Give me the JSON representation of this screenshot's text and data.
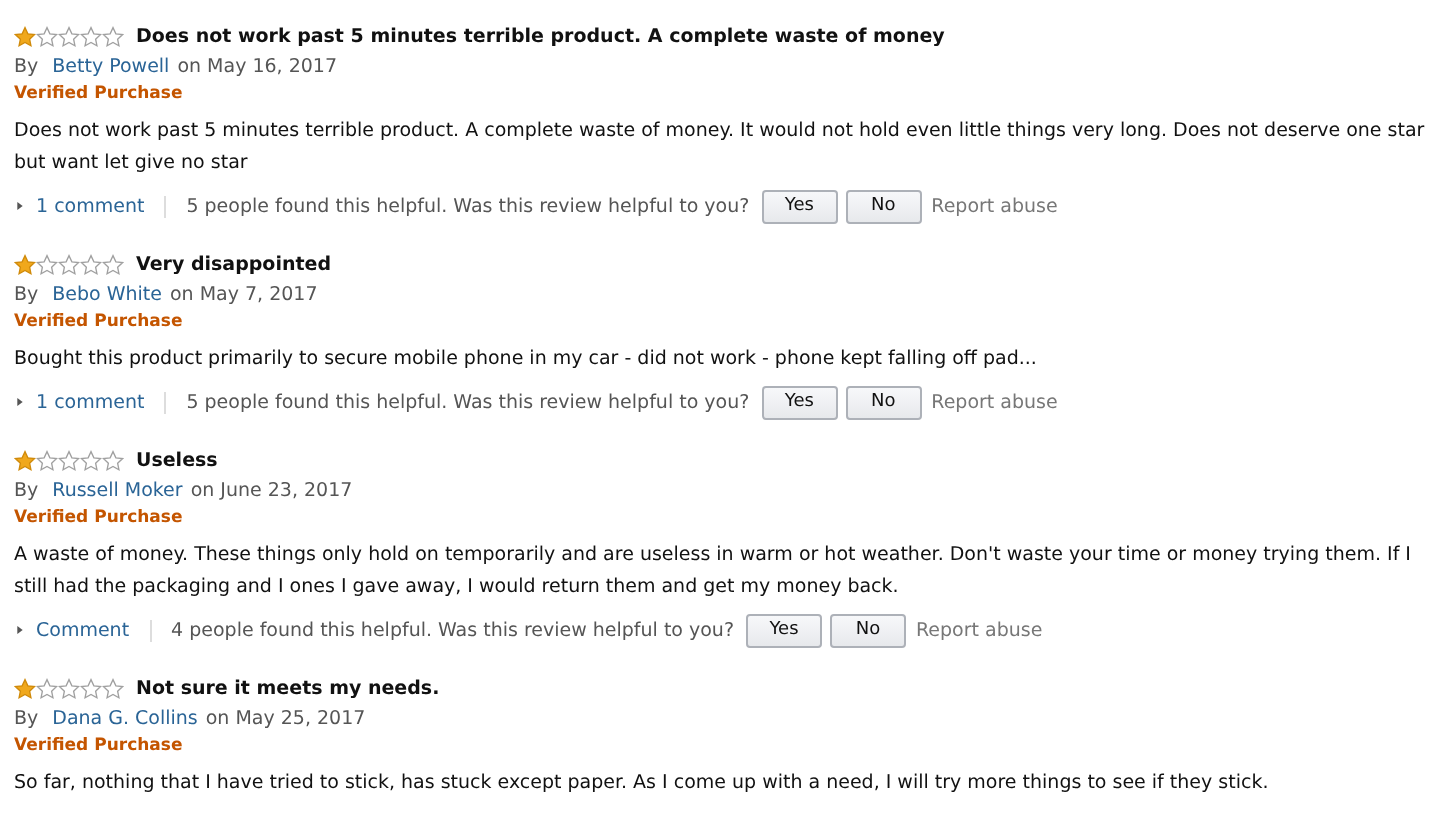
{
  "reviews": [
    {
      "stars": 1,
      "title": "Does not work past 5 minutes terrible product. A complete waste of money",
      "by": "By",
      "author": "Betty Powell",
      "date": "on May 16, 2017",
      "badge": "Verified Purchase",
      "body": "Does not work past 5 minutes terrible product. A complete waste of money. It would not hold even little things very long. Does not deserve one star but want let give no star",
      "comments": "1 comment",
      "helpful": "5 people found this helpful. Was this review helpful to you?",
      "yes": "Yes",
      "no": "No",
      "report": "Report abuse"
    },
    {
      "stars": 1,
      "title": "Very disappointed",
      "by": "By",
      "author": "Bebo White",
      "date": "on May 7, 2017",
      "badge": "Verified Purchase",
      "body": "Bought this product primarily to secure mobile phone in my car - did not work - phone kept falling off pad...",
      "comments": "1 comment",
      "helpful": "5 people found this helpful. Was this review helpful to you?",
      "yes": "Yes",
      "no": "No",
      "report": "Report abuse"
    },
    {
      "stars": 1,
      "title": "Useless",
      "by": "By",
      "author": "Russell Moker",
      "date": "on June 23, 2017",
      "badge": "Verified Purchase",
      "body": "A waste of money. These things only hold on temporarily and are useless in warm or hot weather. Don't waste your time or money trying them. If I still had the packaging and I ones I gave away, I would return them and get my money back.",
      "comments": "Comment",
      "helpful": "4 people found this helpful. Was this review helpful to you?",
      "yes": "Yes",
      "no": "No",
      "report": "Report abuse"
    },
    {
      "stars": 1,
      "title": "Not sure it meets my needs.",
      "by": "By",
      "author": "Dana G. Collins",
      "date": "on May 25, 2017",
      "badge": "Verified Purchase",
      "body": "So far, nothing that I have tried to stick, has stuck except paper. As I come up with a need, I will try more things to see if they stick."
    }
  ]
}
